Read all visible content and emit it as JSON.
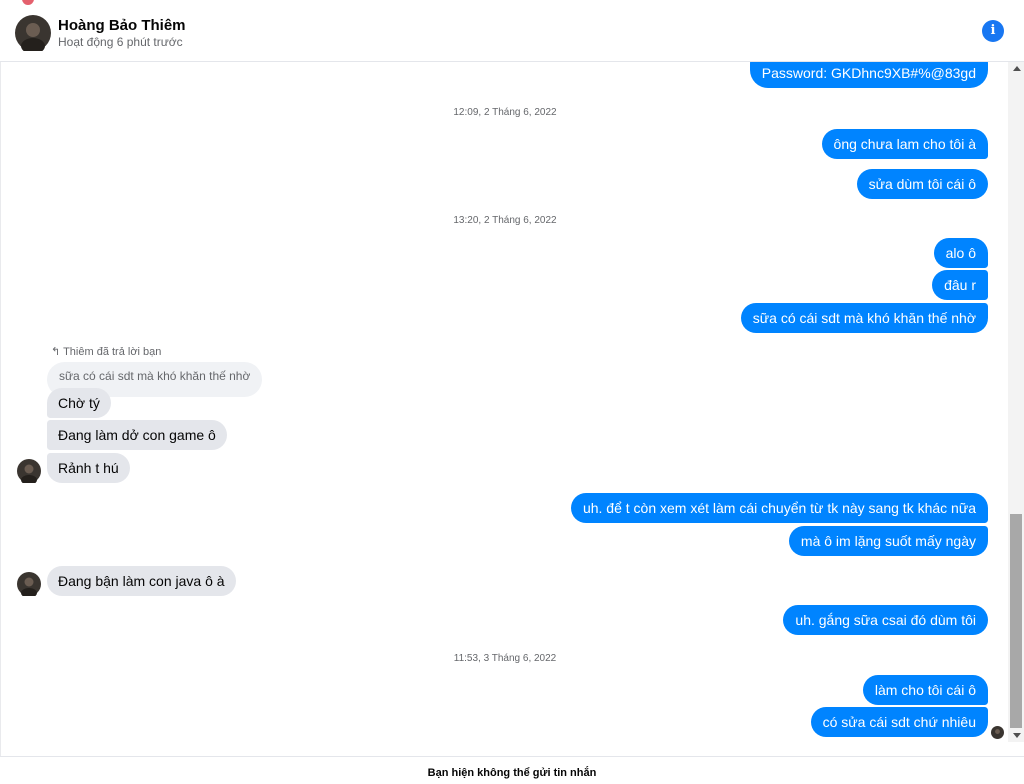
{
  "header": {
    "name": "Hoàng Bảo Thiêm",
    "status": "Hoạt động 6 phút trước",
    "info_icon": "i"
  },
  "messages": {
    "m0": "Password: GKDhnc9XB#%@83gd",
    "ts1": "12:09, 2 Tháng 6, 2022",
    "m1": "ông chưa lam cho tôi à",
    "m2": "sửa dùm tôi cái ô",
    "ts2": "13:20, 2 Tháng 6, 2022",
    "m3": "alo ô",
    "m4": "đâu r",
    "m5": "sữa có cái sdt mà khó khăn thế nhờ",
    "reply_note": "Thiêm đã trả lời bạn",
    "reply_quote": "sữa có cái sdt mà khó khăn thế nhờ",
    "in1": "Chờ tý",
    "in2": "Đang làm dở con game ô",
    "in3": "Rảnh t hú",
    "m6": "uh. để t còn xem xét làm cái chuyển từ tk này sang tk khác nữa",
    "m7": "mà ô im lặng suốt mấy ngày",
    "in4": "Đang bận làm con java ô à",
    "m8": "uh. gắng sữa csai đó dùm tôi",
    "ts3": "11:53, 3 Tháng 6, 2022",
    "m9": "làm cho tôi cái ô",
    "m10": "có sửa cái sdt chứ nhiêu"
  },
  "footer": {
    "notice": "Bạn hiện không thể gửi tin nhắn"
  },
  "colors": {
    "outgoing": "#0084ff",
    "incoming": "#e4e6eb",
    "accent": "#1877f2"
  }
}
